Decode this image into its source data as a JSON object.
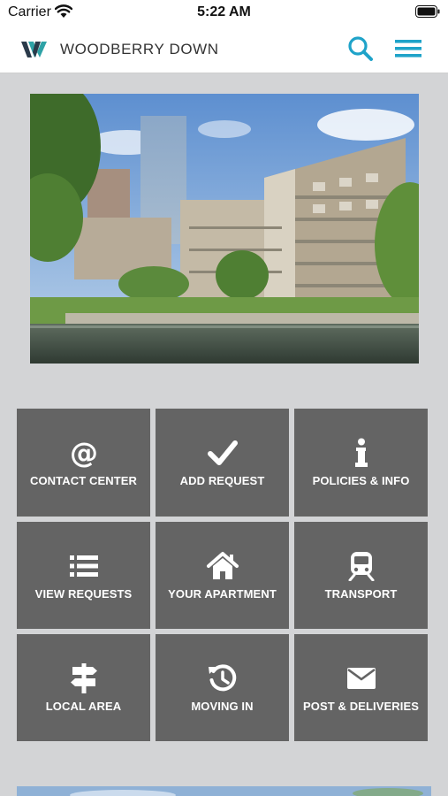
{
  "status_bar": {
    "carrier": "Carrier",
    "time": "5:22 AM"
  },
  "header": {
    "brand": "WOODBERRY DOWN"
  },
  "colors": {
    "accent": "#1fa3c9",
    "tile": "#646464",
    "background": "#d3d4d6"
  },
  "tiles": [
    {
      "label": "CONTACT CENTER",
      "icon": "at-icon"
    },
    {
      "label": "ADD REQUEST",
      "icon": "check-icon"
    },
    {
      "label": "POLICIES & INFO",
      "icon": "info-icon"
    },
    {
      "label": "VIEW REQUESTS",
      "icon": "list-icon"
    },
    {
      "label": "YOUR APARTMENT",
      "icon": "home-icon"
    },
    {
      "label": "TRANSPORT",
      "icon": "train-icon"
    },
    {
      "label": "LOCAL AREA",
      "icon": "signpost-icon"
    },
    {
      "label": "MOVING IN",
      "icon": "history-icon"
    },
    {
      "label": "POST & DELIVERIES",
      "icon": "envelope-icon"
    }
  ]
}
